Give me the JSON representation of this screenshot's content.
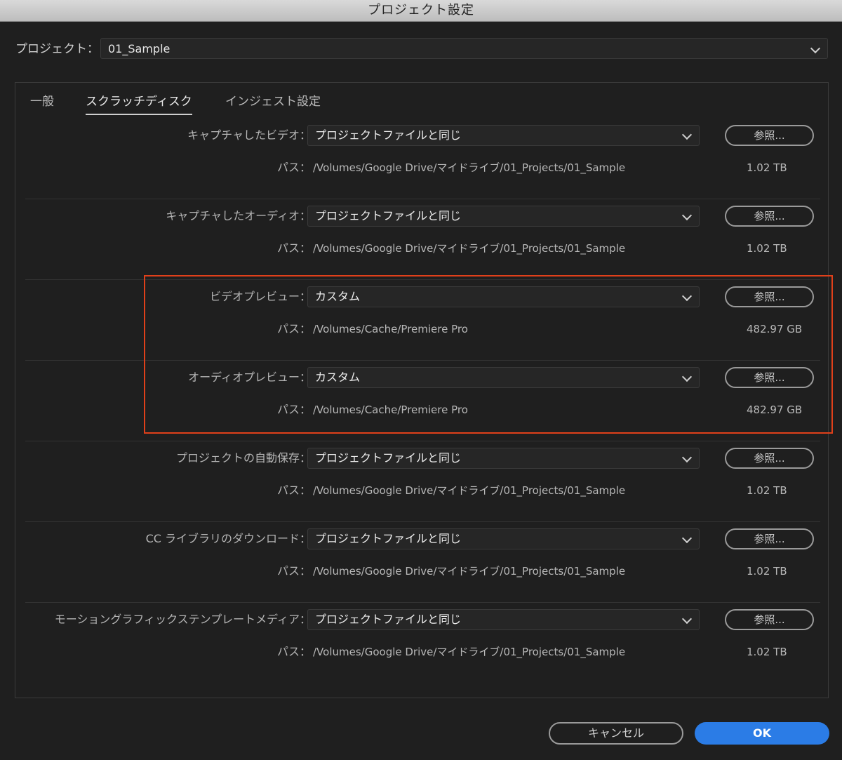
{
  "window": {
    "title": "プロジェクト設定"
  },
  "project": {
    "label": "プロジェクト：",
    "value": "01_Sample"
  },
  "tabs": [
    {
      "label": "一般"
    },
    {
      "label": "スクラッチディスク"
    },
    {
      "label": "インジェスト設定"
    }
  ],
  "path_label": "パス：",
  "browse_label": "参照...",
  "sections": [
    {
      "label": "キャプチャしたビデオ：",
      "value": "プロジェクトファイルと同じ",
      "path": "/Volumes/Google Drive/マイドライブ/01_Projects/01_Sample",
      "size": "1.02 TB"
    },
    {
      "label": "キャプチャしたオーディオ：",
      "value": "プロジェクトファイルと同じ",
      "path": "/Volumes/Google Drive/マイドライブ/01_Projects/01_Sample",
      "size": "1.02 TB"
    },
    {
      "label": "ビデオプレビュー：",
      "value": "カスタム",
      "path": "/Volumes/Cache/Premiere Pro",
      "size": "482.97 GB"
    },
    {
      "label": "オーディオプレビュー：",
      "value": "カスタム",
      "path": "/Volumes/Cache/Premiere Pro",
      "size": "482.97 GB"
    },
    {
      "label": "プロジェクトの自動保存：",
      "value": "プロジェクトファイルと同じ",
      "path": "/Volumes/Google Drive/マイドライブ/01_Projects/01_Sample",
      "size": "1.02 TB"
    },
    {
      "label": "CC ライブラリのダウンロード：",
      "value": "プロジェクトファイルと同じ",
      "path": "/Volumes/Google Drive/マイドライブ/01_Projects/01_Sample",
      "size": "1.02 TB"
    },
    {
      "label": "モーショングラフィックステンプレートメディア：",
      "value": "プロジェクトファイルと同じ",
      "path": "/Volumes/Google Drive/マイドライブ/01_Projects/01_Sample",
      "size": "1.02 TB"
    }
  ],
  "buttons": {
    "cancel": "キャンセル",
    "ok": "OK"
  },
  "colors": {
    "accent": "#2b7ce6",
    "highlight": "#e0401a",
    "background": "#1f1f1f"
  }
}
